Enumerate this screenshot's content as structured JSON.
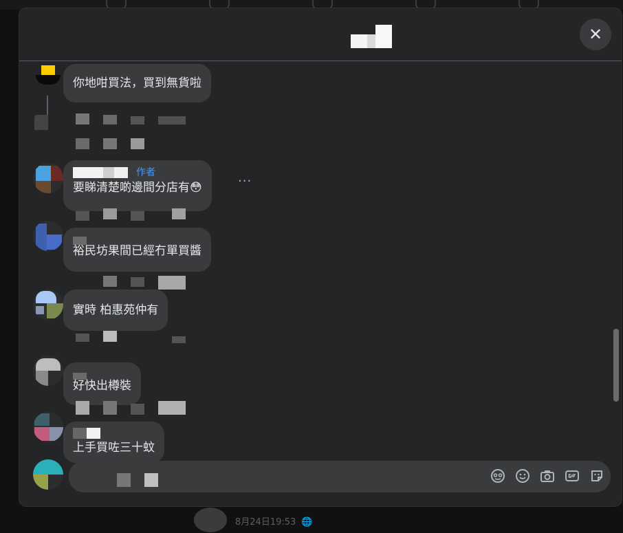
{
  "background": {
    "post_time": "8月24日19:53",
    "globe_glyph": "🌐"
  },
  "modal": {
    "close_glyph": "✕"
  },
  "comments": [
    {
      "text": "你地咁買法，買到無貨啦"
    },
    {
      "author_tag": "作者",
      "text": "要睇清楚啲邊間分店有😳"
    },
    {
      "text": "裕民坊果間已經冇單買醬"
    },
    {
      "text": "實時 柏惠苑仲有"
    },
    {
      "text": "好快出樽裝"
    },
    {
      "text": "上手買咗三十蚊"
    }
  ],
  "more_glyph": "···",
  "composer": {
    "icons": [
      "sticker-face-icon",
      "emoji-icon",
      "camera-icon",
      "gif-icon",
      "sticker-icon"
    ]
  },
  "colors": {
    "modal_bg": "#242526",
    "bubble_bg": "#3a3b3c",
    "author_tag": "#4599ff",
    "text": "#e4e6eb"
  }
}
